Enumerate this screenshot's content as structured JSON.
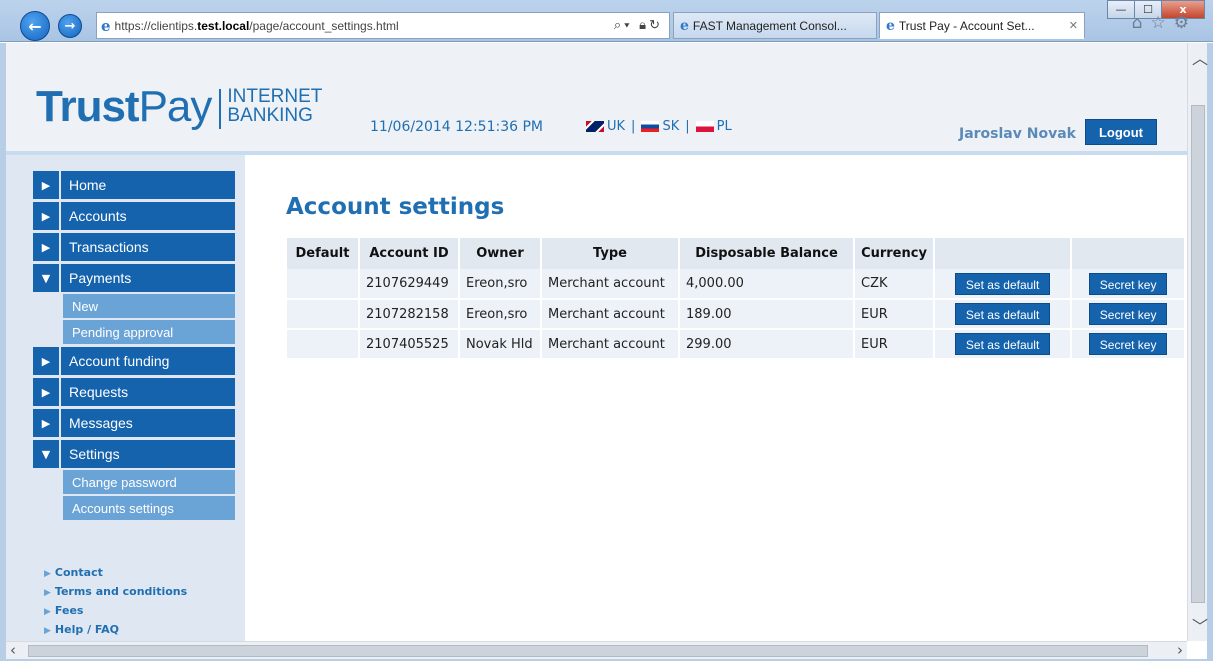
{
  "browser": {
    "url_prefix": "https://clientips.",
    "url_host": "test.local",
    "url_path": "/page/account_settings.html",
    "tabs": [
      {
        "title": "FAST Management Consol..."
      },
      {
        "title": "Trust Pay - Account Set...",
        "active": true
      }
    ],
    "window_controls": {
      "minimize": "—",
      "maximize": "☐",
      "close": "x"
    }
  },
  "header": {
    "logo_trust": "Trust",
    "logo_pay": "Pay",
    "logo_sub_line1": "INTERNET",
    "logo_sub_line2": "BANKING",
    "datetime": "11/06/2014 12:51:36 PM",
    "languages": [
      {
        "code": "UK",
        "flag": "uk"
      },
      {
        "code": "SK",
        "flag": "sk"
      },
      {
        "code": "PL",
        "flag": "pl"
      }
    ],
    "user_name": "Jaroslav Novak",
    "logout_label": "Logout"
  },
  "sidebar": {
    "menu": [
      {
        "label": "Home",
        "expanded": false
      },
      {
        "label": "Accounts",
        "expanded": false
      },
      {
        "label": "Transactions",
        "expanded": false
      },
      {
        "label": "Payments",
        "expanded": true,
        "children": [
          "New",
          "Pending approval"
        ]
      },
      {
        "label": "Account funding",
        "expanded": false
      },
      {
        "label": "Requests",
        "expanded": false
      },
      {
        "label": "Messages",
        "expanded": false
      },
      {
        "label": "Settings",
        "expanded": true,
        "children": [
          "Change password",
          "Accounts settings"
        ]
      }
    ],
    "footer_links": [
      "Contact",
      "Terms and conditions",
      "Fees",
      "Help / FAQ"
    ]
  },
  "main": {
    "title": "Account settings",
    "table": {
      "headers": [
        "Default",
        "Account ID",
        "Owner",
        "Type",
        "Disposable Balance",
        "Currency",
        ""
      ],
      "rows": [
        {
          "default": "",
          "account_id": "2107629449",
          "owner": "Ereon,sro",
          "type": "Merchant account",
          "balance": "4,000.00",
          "currency": "CZK"
        },
        {
          "default": "",
          "account_id": "2107282158",
          "owner": "Ereon,sro",
          "type": "Merchant account",
          "balance": "189.00",
          "currency": "EUR"
        },
        {
          "default": "",
          "account_id": "2107405525",
          "owner": "Novak Hld",
          "type": "Merchant account",
          "balance": "299.00",
          "currency": "EUR"
        }
      ],
      "set_default_label": "Set as default",
      "secret_key_label": "Secret key"
    }
  },
  "colors": {
    "brand_blue": "#1563ad",
    "submenu_blue": "#6aa3d6",
    "title_blue": "#1f6fb2"
  }
}
